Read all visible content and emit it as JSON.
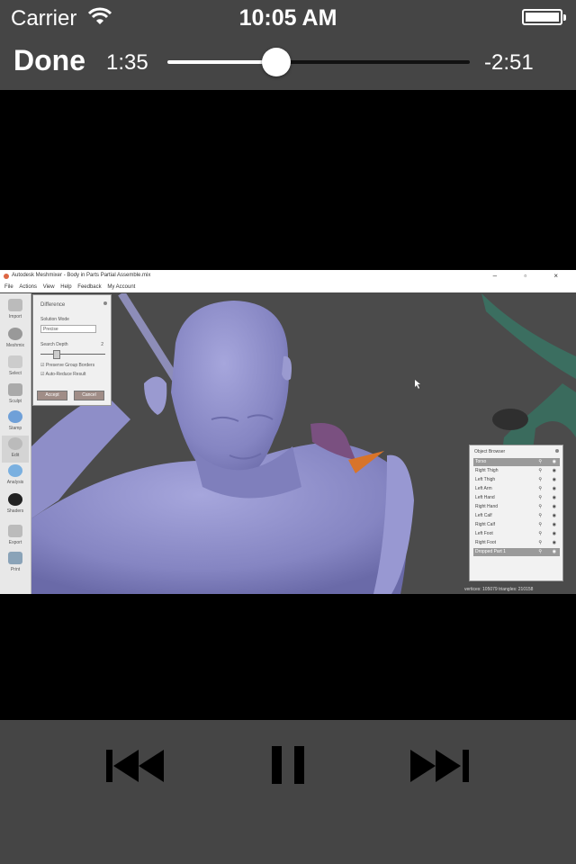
{
  "status_bar": {
    "carrier": "Carrier",
    "time": "10:05 AM"
  },
  "player": {
    "done_label": "Done",
    "elapsed": "1:35",
    "remaining": "-2:51",
    "progress": 0.36
  },
  "video": {
    "window_title": "Autodesk Meshmixer - Body in Parts Partial Assemble.mix",
    "menu": [
      "File",
      "Actions",
      "View",
      "Help",
      "Feedback",
      "My Account"
    ],
    "tools": [
      "Import",
      "Meshmix",
      "Select",
      "Sculpt",
      "Stamp",
      "Edit",
      "Analysis",
      "Shaders",
      "Export",
      "Print"
    ],
    "difference_panel": {
      "title": "Difference",
      "solution_mode_label": "Solution Mode",
      "solution_mode_value": "Precise",
      "search_depth_label": "Search Depth",
      "search_depth_value": "2",
      "preserve_label": "Preserve Group Borders",
      "auto_reduce_label": "Auto-Reduce Result",
      "accept_label": "Accept",
      "cancel_label": "Cancel"
    },
    "object_browser": {
      "title": "Object Browser",
      "items": [
        "Torso",
        "Right Thigh",
        "Left Thigh",
        "Left Arm",
        "Left Hand",
        "Right Hand",
        "Left Calf",
        "Right Calf",
        "Left Foot",
        "Right Foot",
        "Dropped Part 1"
      ],
      "selected": [
        "Torso",
        "Dropped Part 1"
      ]
    },
    "status_text": "vertices: 105079 triangles: 210158"
  },
  "controls": {
    "previous": "previous-track",
    "pause": "pause",
    "next": "next-track"
  },
  "colors": {
    "chrome": "#454545",
    "mesh": "#8f8fc9",
    "viewport": "#4b4b4b"
  }
}
